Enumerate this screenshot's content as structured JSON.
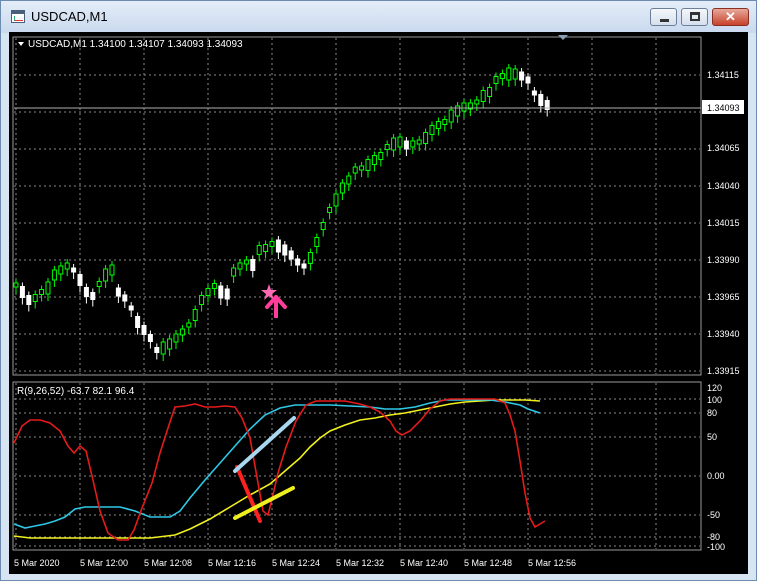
{
  "window": {
    "title": "USDCAD,M1"
  },
  "price_chart": {
    "header": "USDCAD,M1  1.34100 1.34107 1.34093 1.34093",
    "price_levels": [
      "1.34115",
      "1.34065",
      "1.34040",
      "1.34015",
      "1.33990",
      "1.33965",
      "1.33940",
      "1.33915"
    ],
    "current_price": "1.34093",
    "colors": {
      "bull": "#00ff00",
      "bear": "#ffffff",
      "grid": "#8a8a8a",
      "star": "#ff69b4",
      "arrow": "#ff3d9a"
    }
  },
  "indicator": {
    "label": "R(9,26,52) -63.7 82.1 96.4",
    "levels": [
      "120",
      "100",
      "80",
      "50",
      "0.00",
      "-50",
      "-80",
      "-100"
    ],
    "colors": {
      "red": "#e61a1a",
      "cyan": "#2ec8e6",
      "yellow": "#f0f01e",
      "light_blue": "#a8d8f0"
    }
  },
  "time_axis": [
    "5 Mar 2020",
    "5 Mar 12:00",
    "5 Mar 12:08",
    "5 Mar 12:16",
    "5 Mar 12:24",
    "5 Mar 12:32",
    "5 Mar 12:40",
    "5 Mar 12:48",
    "5 Mar 12:56"
  ]
}
